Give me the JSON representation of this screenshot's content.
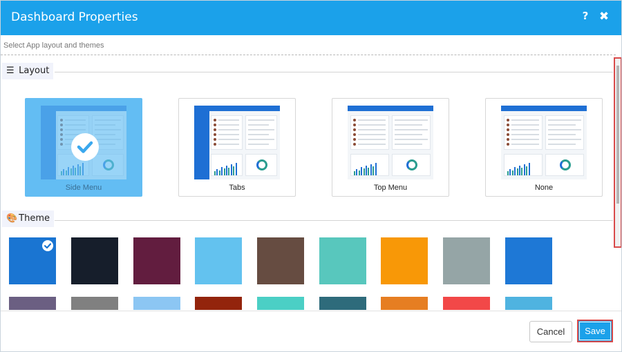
{
  "dialog": {
    "title": "Dashboard Properties",
    "help_icon": "question-mark-icon",
    "close_icon": "close-x-icon",
    "subtitle": "Select App layout and themes"
  },
  "layout_section": {
    "label": "Layout",
    "icon": "hamburger-menu-icon",
    "options": [
      {
        "label": "Side Menu",
        "selected": true,
        "style": "side"
      },
      {
        "label": "Tabs",
        "selected": false,
        "style": "side"
      },
      {
        "label": "Top Menu",
        "selected": false,
        "style": "top"
      },
      {
        "label": "None",
        "selected": false,
        "style": "top"
      }
    ]
  },
  "theme_section": {
    "label": "Theme",
    "icon": "palette-icon",
    "swatches": [
      {
        "color": "#1a75d2",
        "selected": true
      },
      {
        "color": "#161e2b",
        "selected": false
      },
      {
        "color": "#621d3f",
        "selected": false
      },
      {
        "color": "#63c2ef",
        "selected": false
      },
      {
        "color": "#664c41",
        "selected": false
      },
      {
        "color": "#58c7bd",
        "selected": false
      },
      {
        "color": "#f89807",
        "selected": false
      },
      {
        "color": "#95a5a6",
        "selected": false
      },
      {
        "color": "#1e78d6",
        "selected": false
      },
      {
        "color": "#6b5f82",
        "selected": false
      },
      {
        "color": "#808080",
        "selected": false
      },
      {
        "color": "#8cc6f3",
        "selected": false
      },
      {
        "color": "#93240c",
        "selected": false
      },
      {
        "color": "#4bcfc5",
        "selected": false
      },
      {
        "color": "#2e6b7b",
        "selected": false
      },
      {
        "color": "#e67e22",
        "selected": false
      },
      {
        "color": "#f24848",
        "selected": false
      },
      {
        "color": "#4fb3e0",
        "selected": false
      }
    ]
  },
  "footer": {
    "cancel_label": "Cancel",
    "save_label": "Save"
  },
  "colors": {
    "header": "#1ba1ea",
    "selected_layout": "#63bdf3",
    "highlight": "#d94a4a"
  }
}
